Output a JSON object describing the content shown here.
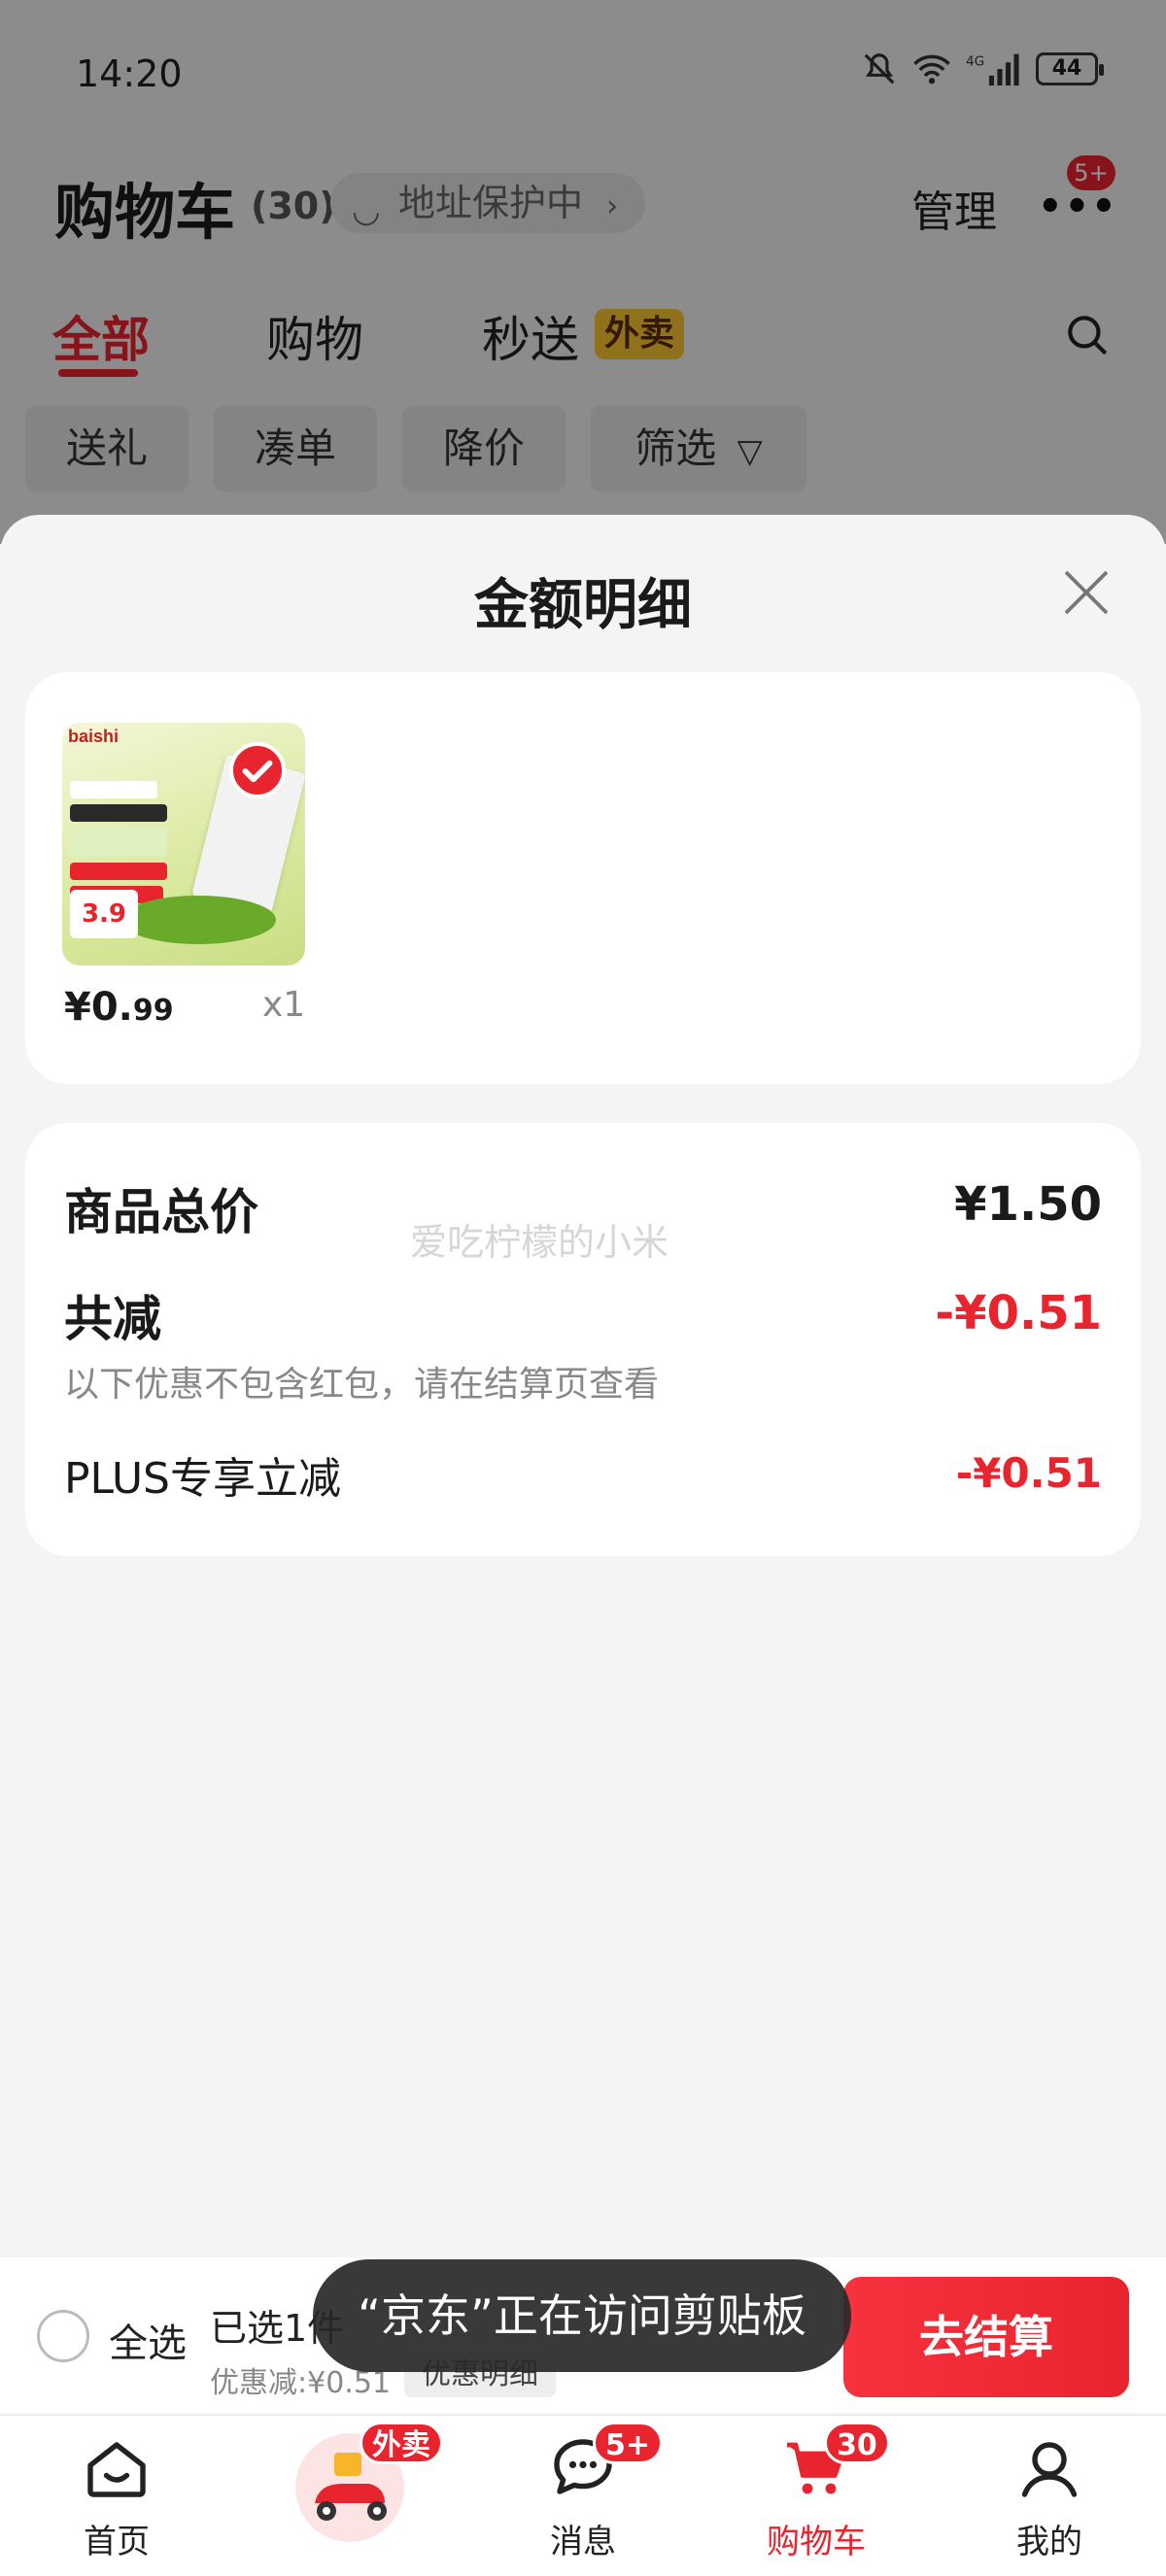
{
  "status_bar": {
    "time": "14:20",
    "battery": "44",
    "icons": [
      "mute-icon",
      "wifi-icon",
      "signal-4g-icon",
      "battery-icon"
    ]
  },
  "header": {
    "title": "购物车",
    "count": "(30)",
    "address_protect": "地址保护中",
    "manage": "管理",
    "more_badge": "5+"
  },
  "tabs": [
    {
      "label": "全部",
      "active": true
    },
    {
      "label": "购物",
      "active": false
    },
    {
      "label": "秒送",
      "active": false
    }
  ],
  "waimai_tag": "外卖",
  "chips": [
    {
      "label": "送礼"
    },
    {
      "label": "凑单"
    },
    {
      "label": "降价"
    },
    {
      "label": "筛选"
    }
  ],
  "sheet": {
    "title": "金额明细",
    "product": {
      "brand": "baishi",
      "thumb_price": "3.9",
      "price_main": "¥0.",
      "price_cents": "99",
      "qty": "x1"
    },
    "summary": {
      "total_label": "商品总价",
      "total_value": "¥1.50",
      "discount_label": "共减",
      "discount_value": "-¥0.51",
      "note": "以下优惠不包含红包，请在结算页查看",
      "plus_label": "PLUS专享立减",
      "plus_value": "-¥0.51",
      "watermark": "爱吃柠檬的小米"
    }
  },
  "checkout": {
    "select_all": "全选",
    "selected": "已选1件",
    "discount": "优惠减:¥0.51",
    "detail": "优惠明细",
    "button": "去结算"
  },
  "toast": "“京东”正在访问剪贴板",
  "tabbar": {
    "items": [
      {
        "label": "首页",
        "icon": "home-icon"
      },
      {
        "label": "",
        "icon": "scooter-icon",
        "badge": "外卖"
      },
      {
        "label": "消息",
        "icon": "message-icon",
        "badge": "5+"
      },
      {
        "label": "购物车",
        "icon": "cart-icon",
        "badge": "30",
        "active": true
      },
      {
        "label": "我的",
        "icon": "profile-icon"
      }
    ]
  },
  "colors": {
    "accent": "#e8242e",
    "tag_yellow": "#f7c42f"
  }
}
